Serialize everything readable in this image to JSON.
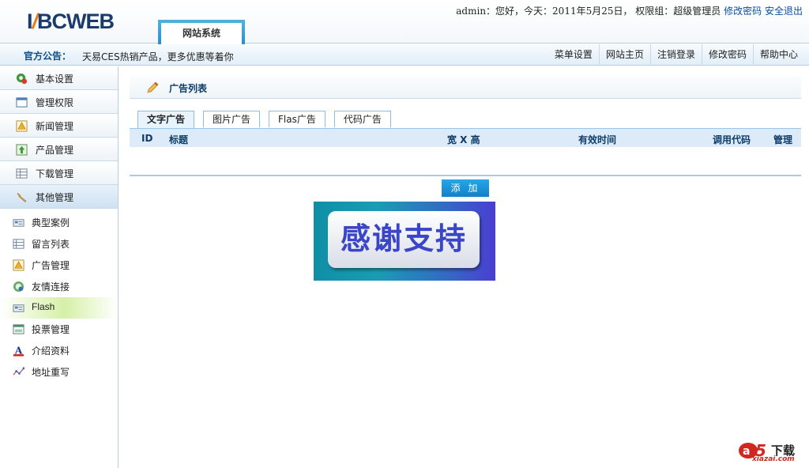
{
  "header": {
    "tab_label": "网站系统",
    "user_info": "admin：您好，今天：2011年5月25日， 权限组：超级管理员",
    "change_password": "修改密码",
    "logout": "安全退出"
  },
  "announcement": {
    "label": "官方公告：",
    "text": "天易CES热销产品，更多优惠等着你"
  },
  "topnav": [
    {
      "label": "菜单设置"
    },
    {
      "label": "网站主页"
    },
    {
      "label": "注销登录"
    },
    {
      "label": "修改密码"
    },
    {
      "label": "帮助中心"
    }
  ],
  "sidebar": {
    "menus": [
      {
        "label": "基本设置",
        "icon": "settings-icon"
      },
      {
        "label": "管理权限",
        "icon": "window-icon"
      },
      {
        "label": "新闻管理",
        "icon": "warning-doc-icon"
      },
      {
        "label": "产品管理",
        "icon": "upload-icon"
      },
      {
        "label": "下载管理",
        "icon": "table-icon"
      },
      {
        "label": "其他管理",
        "icon": "wrench-icon"
      }
    ],
    "subitems": [
      {
        "label": "典型案例",
        "icon": "case-icon"
      },
      {
        "label": "留言列表",
        "icon": "list-icon"
      },
      {
        "label": "广告管理",
        "icon": "ad-icon"
      },
      {
        "label": "友情连接",
        "icon": "link-icon"
      },
      {
        "label": "Flash",
        "icon": "flash-icon"
      },
      {
        "label": "投票管理",
        "icon": "vote-icon"
      },
      {
        "label": "介绍资料",
        "icon": "text-a-icon"
      },
      {
        "label": "地址重写",
        "icon": "rewrite-icon"
      }
    ]
  },
  "main": {
    "title": "广告列表",
    "tabs": [
      {
        "label": "文字广告"
      },
      {
        "label": "图片广告"
      },
      {
        "label": "Flas广告"
      },
      {
        "label": "代码广告"
      }
    ],
    "columns": {
      "id": "ID",
      "title": "标题",
      "size": "宽 X 高",
      "valid_time": "有效时间",
      "code": "调用代码",
      "manage": "管理"
    },
    "add_button": "添 加",
    "banner_text": "感谢支持"
  },
  "watermark": {
    "brand": "下载",
    "site": "xiazai.com"
  },
  "colors": {
    "accent": "#2a8fca",
    "header_text": "#0d3c6a",
    "link": "#0b4e9e"
  }
}
